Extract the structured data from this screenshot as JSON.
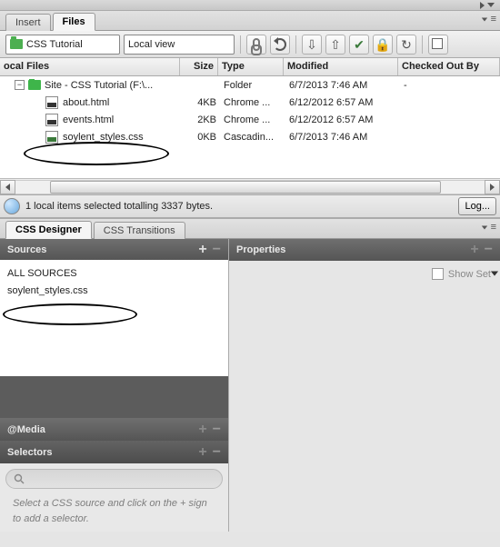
{
  "tabs_top": {
    "insert": "Insert",
    "files": "Files"
  },
  "toolbar": {
    "site_dropdown": "CSS Tutorial",
    "view_dropdown": "Local view"
  },
  "file_columns": {
    "name": "ocal Files",
    "size": "Size",
    "type": "Type",
    "modified": "Modified",
    "checked": "Checked Out By"
  },
  "files": {
    "root": {
      "name": "Site - CSS Tutorial (F:\\...",
      "type": "Folder",
      "modified": "6/7/2013 7:46 AM",
      "checked": "-"
    },
    "rows": [
      {
        "name": "about.html",
        "size": "4KB",
        "type": "Chrome ...",
        "modified": "6/12/2012 6:57 AM"
      },
      {
        "name": "events.html",
        "size": "2KB",
        "type": "Chrome ...",
        "modified": "6/12/2012 6:57 AM"
      },
      {
        "name": "soylent_styles.css",
        "size": "0KB",
        "type": "Cascadin...",
        "modified": "6/7/2013 7:46 AM"
      }
    ]
  },
  "status": {
    "text": "1 local items selected totalling 3337 bytes.",
    "log": "Log..."
  },
  "css_tabs": {
    "designer": "CSS Designer",
    "transitions": "CSS Transitions"
  },
  "panels": {
    "sources": "Sources",
    "media": "@Media",
    "selectors": "Selectors",
    "properties": "Properties"
  },
  "sources_list": {
    "all": "ALL SOURCES",
    "file": "soylent_styles.css"
  },
  "selectors_hint": "Select a CSS source and click on the + sign to add a selector.",
  "properties": {
    "show_set": "Show Set"
  }
}
